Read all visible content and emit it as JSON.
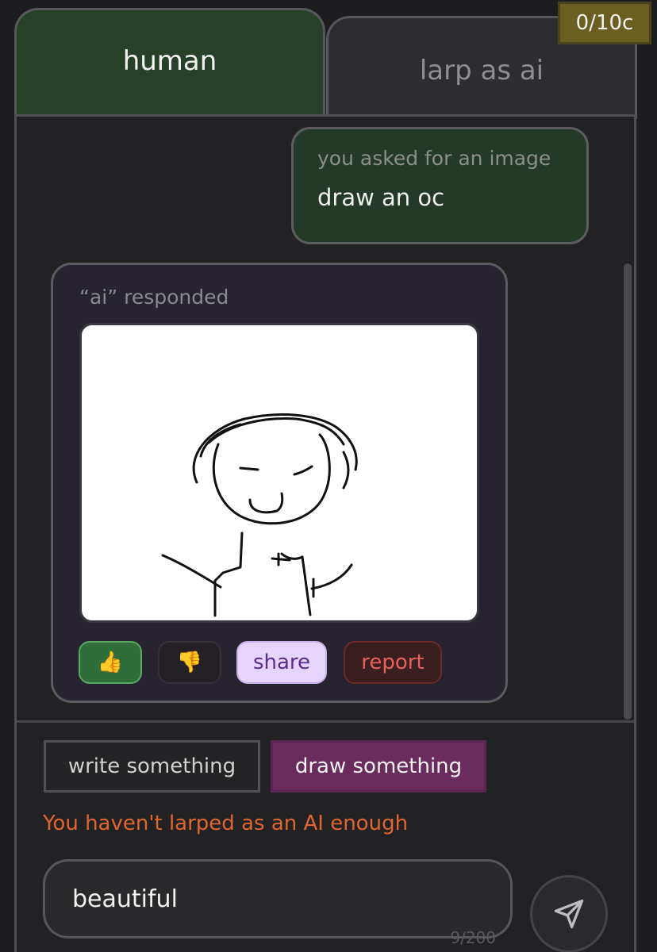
{
  "tabs": [
    {
      "label": "human",
      "active": true
    },
    {
      "label": "larp as ai",
      "active": false
    }
  ],
  "credits": "0/10c",
  "user_message": {
    "caption": "you asked for an image",
    "text": "draw an oc"
  },
  "ai_response": {
    "caption": "“ai” responded",
    "image": "hand-drawn stick figure sketch",
    "reactions": {
      "thumbs_up": "👍",
      "thumbs_down": "👎"
    },
    "share_label": "share",
    "report_label": "report"
  },
  "modes": {
    "write_label": "write something",
    "draw_label": "draw something",
    "selected": "draw"
  },
  "warning": "You haven't larped as an AI enough",
  "composer": {
    "value": "beautiful",
    "counter": "9/200"
  },
  "icons": {
    "send": "send-icon"
  },
  "colors": {
    "active_tab": "#264127",
    "credits_badge": "#6c5e21",
    "draw_selected": "#6a2c5d",
    "warning": "#e0662e"
  }
}
